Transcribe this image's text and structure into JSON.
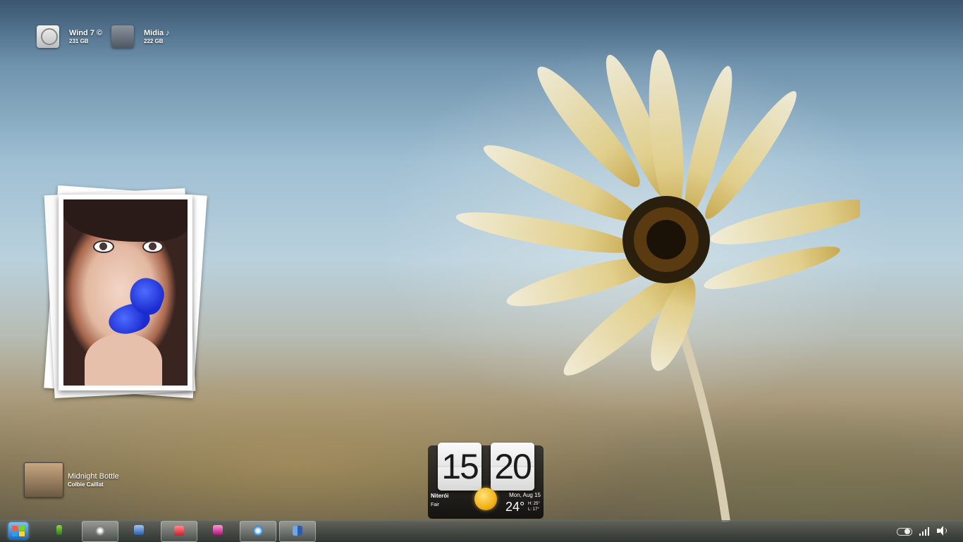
{
  "desktop": {
    "drives": [
      {
        "name": "Wind 7 ©",
        "size": "231 GB",
        "icon": "hard-drive-icon"
      },
      {
        "name": "Midia ♪",
        "size": "222 GB",
        "icon": "network-drive-icon"
      }
    ]
  },
  "music_player": {
    "title": "Midnight Bottle",
    "artist": "Colbie Caillat"
  },
  "clock": {
    "hours": "15",
    "minutes": "20",
    "city": "Niterói",
    "condition": "Fair",
    "date": "Mon, Aug 15",
    "temperature": "24°",
    "high": "H: 25°",
    "low": "L: 17°"
  },
  "taskbar": {
    "items": [
      {
        "icon": "windows-start-icon"
      },
      {
        "icon": "phone-icon"
      },
      {
        "icon": "media-center-icon",
        "active": true
      },
      {
        "icon": "notepad-icon"
      },
      {
        "icon": "photo-app-icon",
        "active": true
      },
      {
        "icon": "media-player-icon"
      },
      {
        "icon": "itunes-icon",
        "active": true
      },
      {
        "icon": "library-icon",
        "active": true
      }
    ],
    "tray": [
      "toggle-icon",
      "signal-icon",
      "volume-icon"
    ]
  }
}
